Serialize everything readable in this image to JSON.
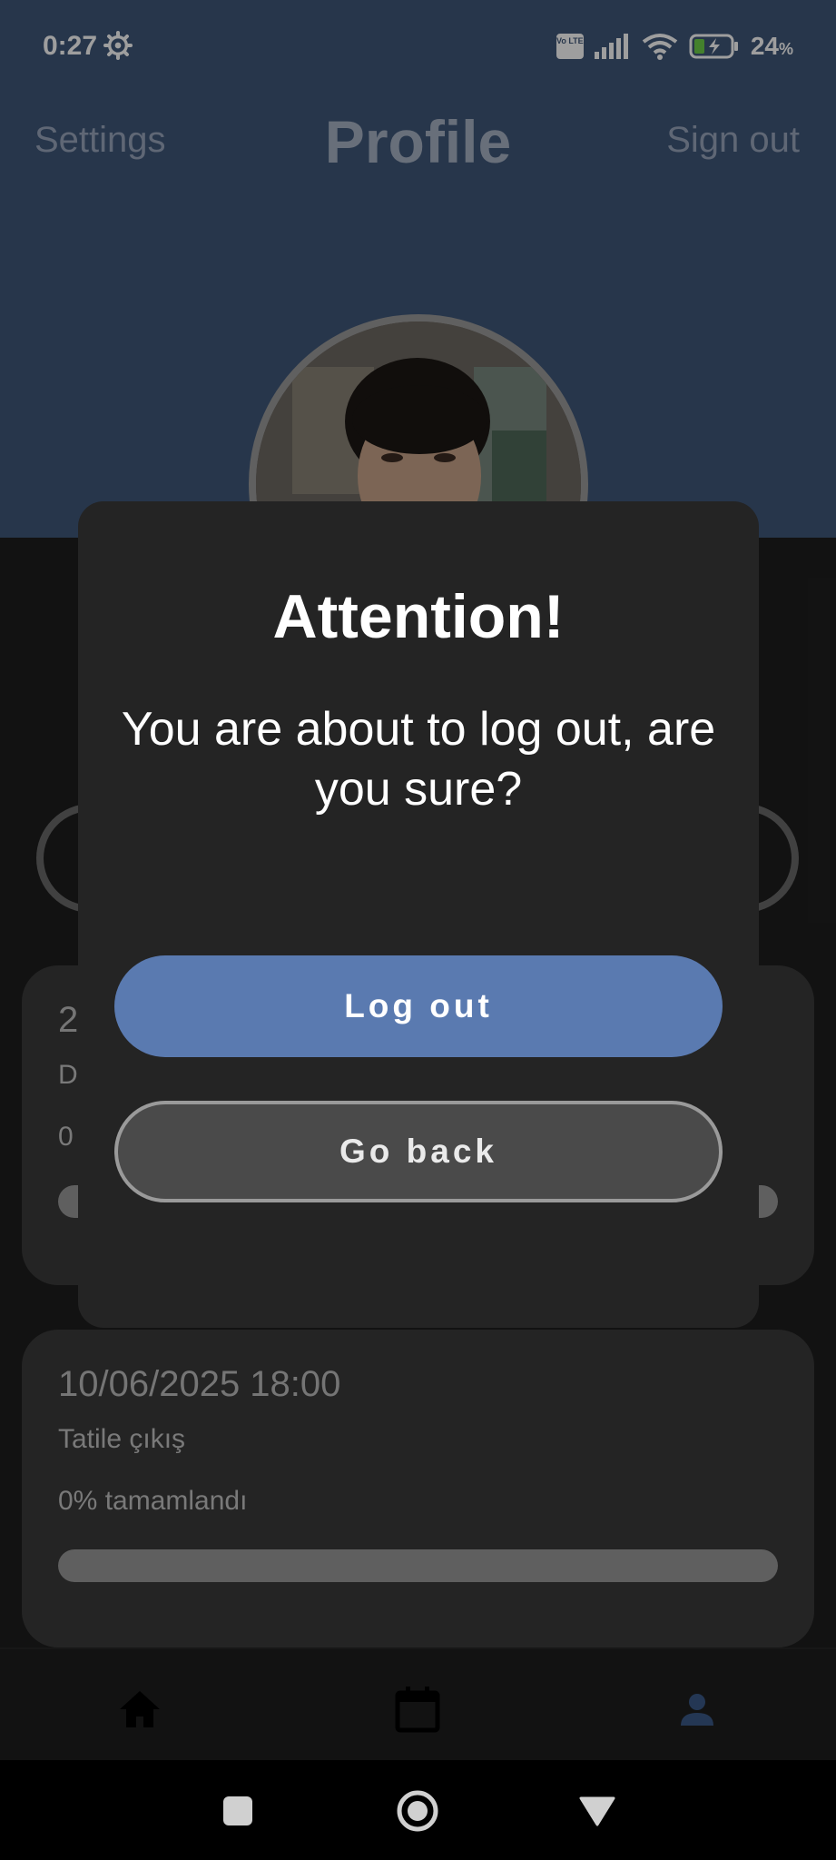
{
  "status_bar": {
    "time": "0:27",
    "network_badge": "Vo LTE",
    "battery": "24",
    "battery_unit": "%"
  },
  "header": {
    "left_action": "Settings",
    "title": "Profile",
    "right_action": "Sign out"
  },
  "tasks": [
    {
      "date": "2",
      "name": "D",
      "progress_text": "0",
      "progress": 0
    },
    {
      "date": "10/06/2025 18:00",
      "name": "Tatile çıkış",
      "progress_text": "0% tamamlandı",
      "progress": 0
    }
  ],
  "dialog": {
    "title": "Attention!",
    "message": "You are about to log out, are you sure?",
    "confirm_label": "Log out",
    "cancel_label": "Go back"
  },
  "bottom_nav": {
    "items": [
      {
        "icon": "home-icon"
      },
      {
        "icon": "calendar-icon"
      },
      {
        "icon": "person-icon",
        "active": true
      }
    ]
  },
  "colors": {
    "header_bg": "#3f5779",
    "accent": "#5a7ab0",
    "dialog_bg": "#242424",
    "card_bg": "#3a3a3a"
  }
}
